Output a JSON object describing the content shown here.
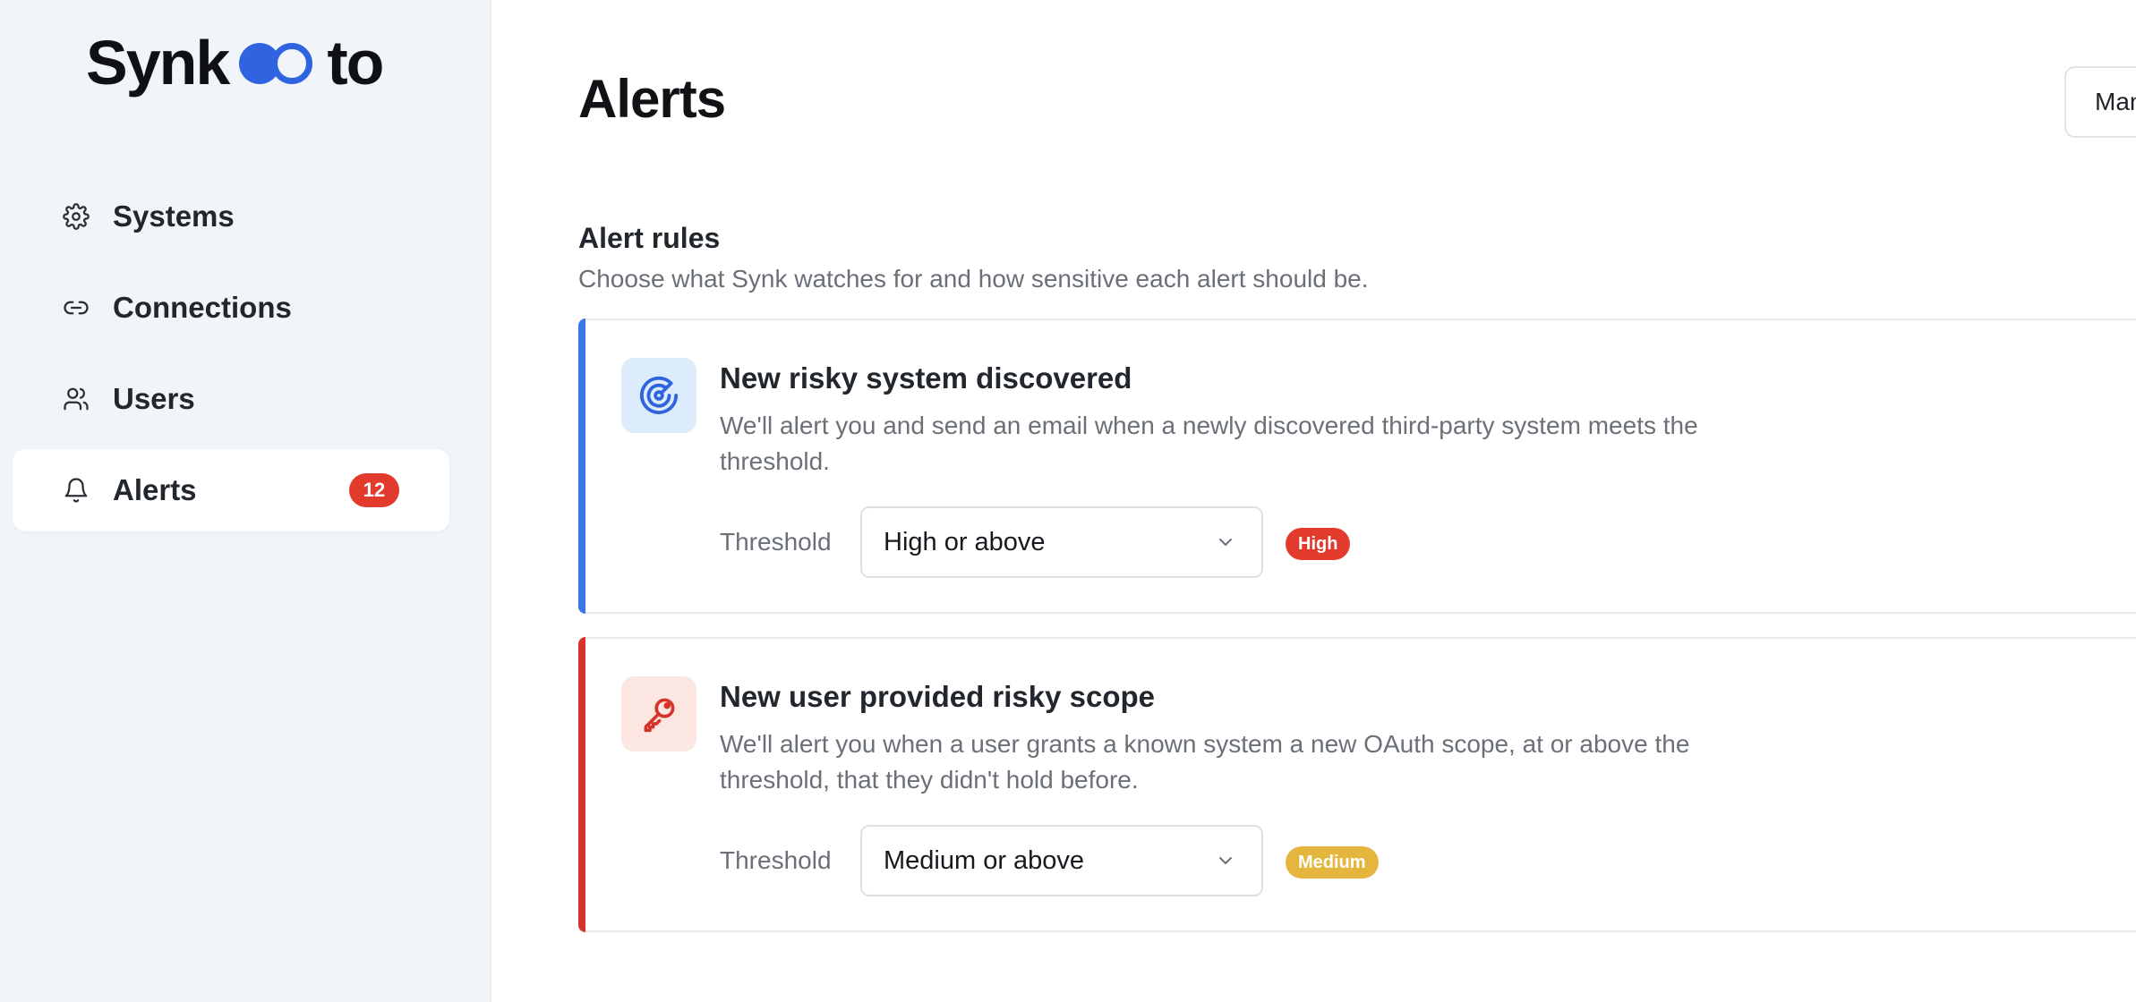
{
  "brand": {
    "left": "Synk",
    "right": "to"
  },
  "sidebar": {
    "items": [
      {
        "label": "Systems",
        "icon": "gear-icon"
      },
      {
        "label": "Connections",
        "icon": "link-icon"
      },
      {
        "label": "Users",
        "icon": "users-icon"
      },
      {
        "label": "Alerts",
        "icon": "bell-icon",
        "badge": "12",
        "active": true
      }
    ]
  },
  "header": {
    "title": "Alerts",
    "action_label": "Man"
  },
  "rules": {
    "title": "Alert rules",
    "subtitle": "Choose what Synk watches for and how sensitive each alert should be.",
    "cards": [
      {
        "title": "New risky system discovered",
        "description": "We'll alert you and send an email when a newly discovered third-party system meets the threshold.",
        "threshold_label": "Threshold",
        "threshold_value": "High or above",
        "severity": "High",
        "accent": "#3a78e6",
        "severity_color": "#e23a2c",
        "icon": "radar-icon"
      },
      {
        "title": "New user provided risky scope",
        "description": "We'll alert you when a user grants a known system a new OAuth scope, at or above the threshold, that they didn't hold before.",
        "threshold_label": "Threshold",
        "threshold_value": "Medium or above",
        "severity": "Medium",
        "accent": "#d6332a",
        "severity_color": "#e5b63e",
        "icon": "key-icon"
      }
    ]
  },
  "colors": {
    "sidebar_bg": "#f1f5f9",
    "brand_blue": "#2f63e0",
    "badge_red": "#e23a2c"
  }
}
